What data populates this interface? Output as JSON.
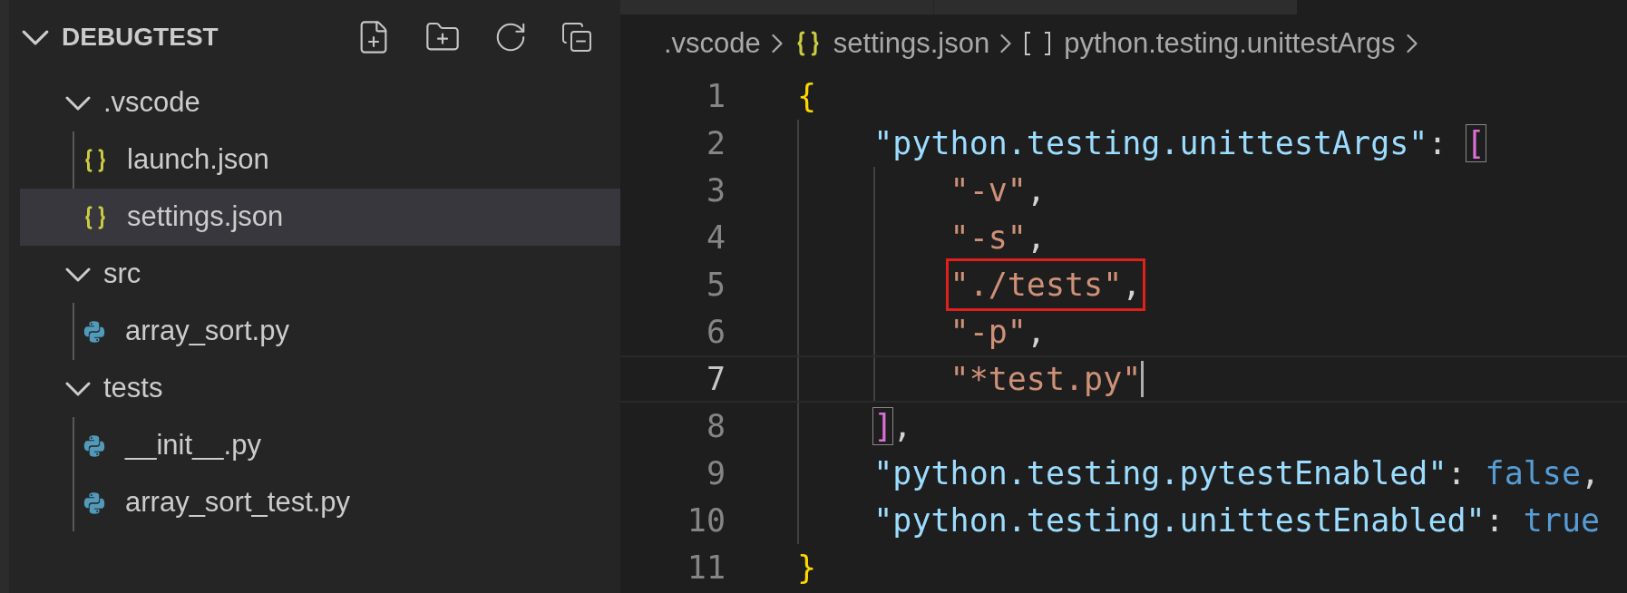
{
  "sidebar": {
    "title": "DEBUGTEST",
    "expanded": true,
    "tree": [
      {
        "label": ".vscode",
        "kind": "folder",
        "expanded": true,
        "children": [
          {
            "label": "launch.json",
            "kind": "json",
            "selected": false
          },
          {
            "label": "settings.json",
            "kind": "json",
            "selected": true
          }
        ]
      },
      {
        "label": "src",
        "kind": "folder",
        "expanded": true,
        "children": [
          {
            "label": "array_sort.py",
            "kind": "python",
            "selected": false
          }
        ]
      },
      {
        "label": "tests",
        "kind": "folder",
        "expanded": true,
        "children": [
          {
            "label": "__init__.py",
            "kind": "python",
            "selected": false
          },
          {
            "label": "array_sort_test.py",
            "kind": "python",
            "selected": false
          }
        ]
      }
    ]
  },
  "editor": {
    "breadcrumbs": [
      {
        "label": ".vscode",
        "kind": "folder"
      },
      {
        "label": "settings.json",
        "kind": "json"
      },
      {
        "label": "python.testing.unittestArgs",
        "kind": "array"
      }
    ],
    "lines": [
      {
        "number": "1",
        "current": false,
        "boxed": false,
        "tokens": [
          {
            "text": "{",
            "kind": "brace"
          }
        ],
        "children": [
          {
            "number": "2",
            "current": false,
            "boxed": false,
            "tokens": [
              {
                "text": "\"python.testing.unittestArgs\"",
                "kind": "key"
              },
              {
                "text": ": ",
                "kind": "punct"
              },
              {
                "text": "[",
                "kind": "bracket",
                "matched": true
              }
            ],
            "children": [
              {
                "number": "3",
                "current": false,
                "boxed": false,
                "tokens": [
                  {
                    "text": "\"-v\"",
                    "kind": "string"
                  },
                  {
                    "text": ",",
                    "kind": "punct"
                  }
                ]
              },
              {
                "number": "4",
                "current": false,
                "boxed": false,
                "tokens": [
                  {
                    "text": "\"-s\"",
                    "kind": "string"
                  },
                  {
                    "text": ",",
                    "kind": "punct"
                  }
                ]
              },
              {
                "number": "5",
                "current": false,
                "boxed": true,
                "tokens": [
                  {
                    "text": "\"./tests\"",
                    "kind": "string"
                  },
                  {
                    "text": ",",
                    "kind": "punct"
                  }
                ]
              },
              {
                "number": "6",
                "current": false,
                "boxed": false,
                "tokens": [
                  {
                    "text": "\"-p\"",
                    "kind": "string"
                  },
                  {
                    "text": ",",
                    "kind": "punct"
                  }
                ]
              },
              {
                "number": "7",
                "current": true,
                "boxed": false,
                "tokens": [
                  {
                    "text": "\"*test.py\"",
                    "kind": "string"
                  }
                ]
              }
            ]
          },
          {
            "number": "8",
            "current": false,
            "boxed": false,
            "tokens": [
              {
                "text": "]",
                "kind": "bracket",
                "matched": true
              },
              {
                "text": ",",
                "kind": "punct"
              }
            ]
          },
          {
            "number": "9",
            "current": false,
            "boxed": false,
            "tokens": [
              {
                "text": "\"python.testing.pytestEnabled\"",
                "kind": "key"
              },
              {
                "text": ": ",
                "kind": "punct"
              },
              {
                "text": "false",
                "kind": "bool"
              },
              {
                "text": ",",
                "kind": "punct"
              }
            ]
          },
          {
            "number": "10",
            "current": false,
            "boxed": false,
            "tokens": [
              {
                "text": "\"python.testing.unittestEnabled\"",
                "kind": "key"
              },
              {
                "text": ": ",
                "kind": "punct"
              },
              {
                "text": "true",
                "kind": "bool"
              }
            ]
          }
        ]
      },
      {
        "number": "11",
        "current": false,
        "boxed": false,
        "tokens": [
          {
            "text": "}",
            "kind": "brace"
          }
        ]
      }
    ]
  }
}
